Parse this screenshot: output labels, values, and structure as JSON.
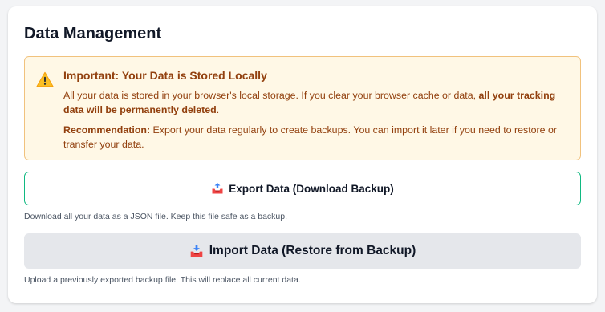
{
  "section": {
    "title": "Data Management"
  },
  "warning": {
    "icon": "warning-icon",
    "title": "Important: Your Data is Stored Locally",
    "p1_text": "All your data is stored in your browser's local storage. If you clear your browser cache or data, ",
    "p1_bold": "all your tracking data will be permanently deleted",
    "p1_end": ".",
    "p2_label": "Recommendation:",
    "p2_text": " Export your data regularly to create backups. You can import it later if you need to restore or transfer your data."
  },
  "export": {
    "icon": "outbox-tray-icon",
    "label": "Export Data (Download Backup)",
    "hint": "Download all your data as a JSON file. Keep this file safe as a backup."
  },
  "import": {
    "icon": "inbox-tray-icon",
    "label": "Import Data (Restore from Backup)",
    "hint": "Upload a previously exported backup file. This will replace all current data."
  },
  "colors": {
    "warning_bg": "#fff8e6",
    "warning_border": "#f1c27d",
    "warning_text": "#92400e",
    "export_border": "#10b981",
    "import_bg": "#e5e7eb"
  }
}
